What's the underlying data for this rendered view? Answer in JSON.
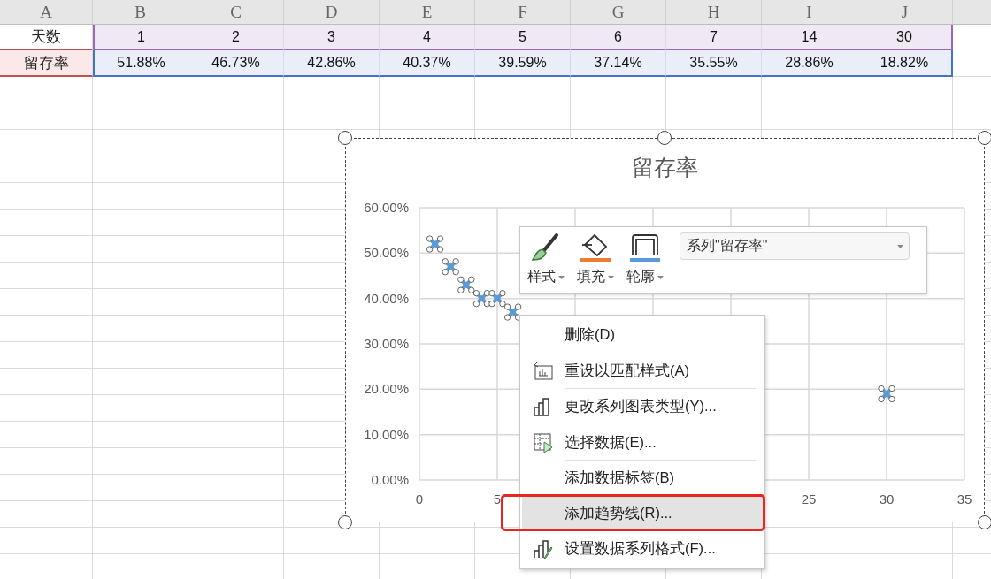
{
  "columns": [
    "A",
    "B",
    "C",
    "D",
    "E",
    "F",
    "G",
    "H",
    "I",
    "J"
  ],
  "rows": [
    {
      "kind": "x_values",
      "label": "天数",
      "cells": [
        "1",
        "2",
        "3",
        "4",
        "5",
        "6",
        "7",
        "14",
        "30"
      ]
    },
    {
      "kind": "y_values",
      "label": "留存率",
      "cells": [
        "51.88%",
        "46.73%",
        "42.86%",
        "40.37%",
        "39.59%",
        "37.14%",
        "35.55%",
        "28.86%",
        "18.82%"
      ]
    }
  ],
  "chart": {
    "chart_data": {
      "type": "scatter",
      "title": "留存率",
      "grid": true,
      "x": [
        1,
        2,
        3,
        4,
        5,
        6,
        30
      ],
      "series": [
        {
          "color": "#5b9bd5",
          "values": [
            0.52,
            0.47,
            0.43,
            0.4,
            0.4,
            0.37,
            0.19
          ]
        }
      ],
      "xlim": [
        0,
        35
      ],
      "ylim": [
        0,
        0.6
      ],
      "xticks": [
        0,
        5,
        25,
        30,
        35
      ],
      "yticks": [
        {
          "value": 0,
          "label": "0.00%"
        },
        {
          "value": 0.1,
          "label": "10.00%"
        },
        {
          "value": 0.2,
          "label": "20.00%"
        },
        {
          "value": 0.3,
          "label": "30.00%"
        },
        {
          "value": 0.4,
          "label": "40.00%"
        },
        {
          "value": 0.5,
          "label": "50.00%"
        },
        {
          "value": 0.6,
          "label": "60.00%"
        }
      ]
    }
  },
  "format_toolbar": {
    "buttons": [
      {
        "label": "样式"
      },
      {
        "label": "填充"
      },
      {
        "label": "轮廓"
      }
    ],
    "series_select": {
      "value": "系列\"留存率\""
    }
  },
  "context_menu": {
    "items": [
      {
        "label": "删除(D)",
        "selected": false,
        "divider_after": false,
        "annotated": false
      },
      {
        "label": "重设以匹配样式(A)",
        "selected": false,
        "divider_after": true,
        "annotated": false
      },
      {
        "label": "更改系列图表类型(Y)...",
        "selected": false,
        "divider_after": false,
        "annotated": false
      },
      {
        "label": "选择数据(E)...",
        "selected": false,
        "divider_after": true,
        "annotated": false
      },
      {
        "label": "添加数据标签(B)",
        "selected": false,
        "divider_after": false,
        "annotated": false
      },
      {
        "label": "添加趋势线(R)...",
        "selected": true,
        "divider_after": false,
        "annotated": true
      },
      {
        "label": "设置数据系列格式(F)...",
        "selected": false,
        "divider_after": false,
        "annotated": false
      }
    ]
  }
}
